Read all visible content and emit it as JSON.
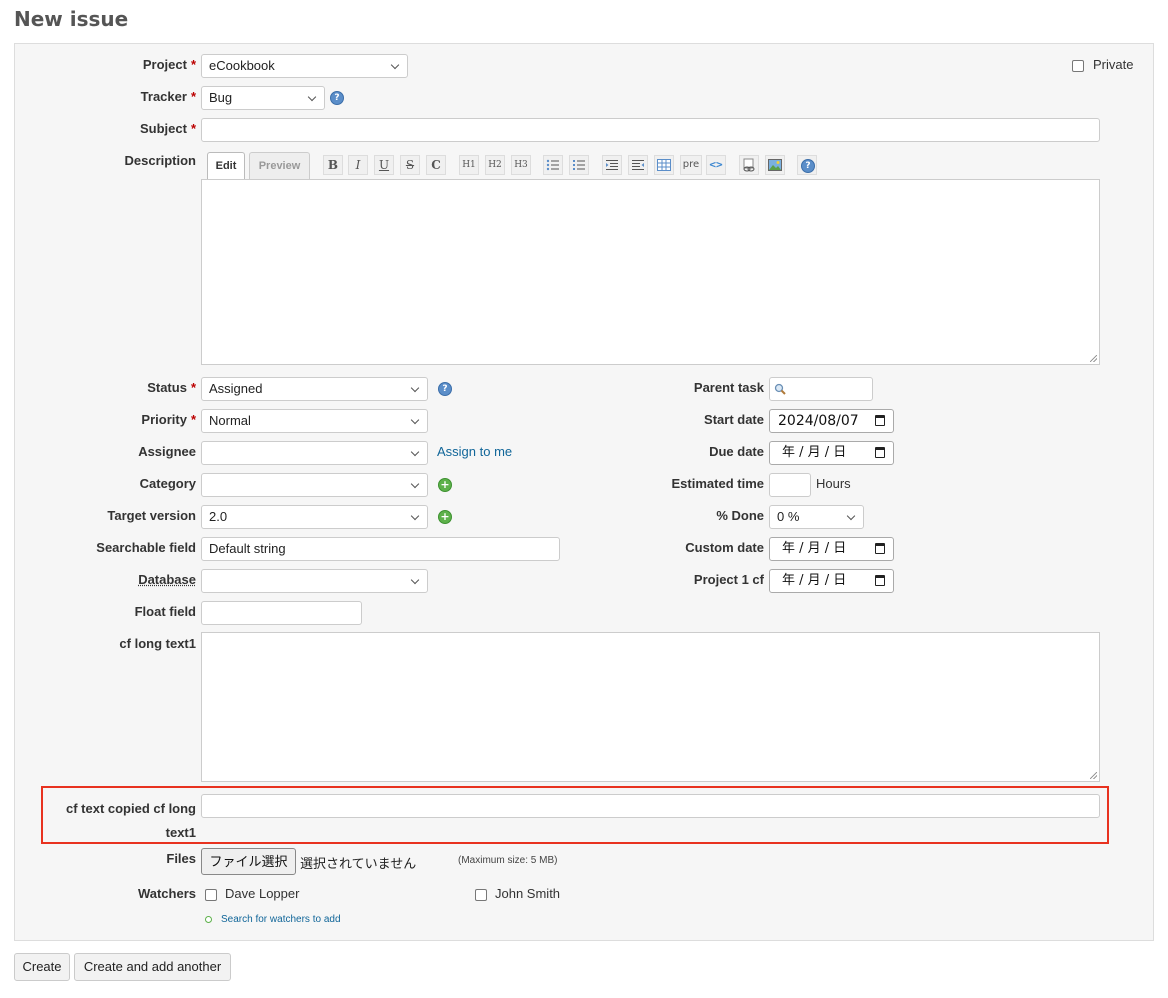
{
  "page_title": "New issue",
  "colors": {
    "accent_link": "#116699",
    "required": "#bb0000",
    "highlight": "#e8321f"
  },
  "fields": {
    "project": {
      "label": "Project",
      "value": "eCookbook"
    },
    "tracker": {
      "label": "Tracker",
      "value": "Bug"
    },
    "private_label": "Private",
    "subject": {
      "label": "Subject",
      "value": ""
    },
    "description": {
      "label": "Description"
    },
    "status": {
      "label": "Status",
      "value": "Assigned"
    },
    "priority": {
      "label": "Priority",
      "value": "Normal"
    },
    "assignee": {
      "label": "Assignee",
      "value": "",
      "assign_to_me": "Assign to me"
    },
    "category": {
      "label": "Category",
      "value": ""
    },
    "target_version": {
      "label": "Target version",
      "value": "2.0"
    },
    "searchable_field": {
      "label": "Searchable field",
      "value": "Default string"
    },
    "database": {
      "label": "Database",
      "value": ""
    },
    "float_field": {
      "label": "Float field",
      "value": ""
    },
    "cf_long_text1": {
      "label": "cf long text1"
    },
    "cf_text_copied_line1": "cf text copied cf long",
    "cf_text_copied_line2": "text1",
    "parent_task": {
      "label": "Parent task",
      "value": ""
    },
    "start_date": {
      "label": "Start date",
      "value": "2024/08/07"
    },
    "due_date": {
      "label": "Due date",
      "value": "年 / 月 / 日"
    },
    "estimated_time": {
      "label": "Estimated time",
      "value": "",
      "unit": "Hours"
    },
    "done_ratio": {
      "label": "% Done",
      "value": "0 %"
    },
    "custom_date": {
      "label": "Custom date",
      "value": "年 / 月 / 日"
    },
    "project1_cf": {
      "label": "Project 1 cf",
      "value": "年 / 月 / 日"
    },
    "files": {
      "label": "Files",
      "button": "ファイル選択",
      "status": "選択されていません",
      "max_size": "(Maximum size: 5 MB)"
    },
    "watchers": {
      "label": "Watchers",
      "users": [
        "Dave Lopper",
        "John Smith"
      ],
      "search_link": "Search for watchers to add"
    }
  },
  "editor": {
    "tab_edit": "Edit",
    "tab_preview": "Preview",
    "toolbar": [
      "bold-icon",
      "italic-icon",
      "underline-icon",
      "strikethrough-icon",
      "code-icon",
      "heading1-icon",
      "heading2-icon",
      "heading3-icon",
      "unordered-list-icon",
      "ordered-list-icon",
      "indent-right-icon",
      "indent-left-icon",
      "table-icon",
      "pre-icon",
      "code-highlight-icon",
      "link-icon",
      "image-icon",
      "help-icon"
    ],
    "toolbar_text": {
      "b": "B",
      "i": "I",
      "u": "U",
      "s": "S",
      "c": "C",
      "h1": "H1",
      "h2": "H2",
      "h3": "H3",
      "pre": "pre"
    }
  },
  "buttons": {
    "create": "Create",
    "create_another": "Create and add another"
  }
}
